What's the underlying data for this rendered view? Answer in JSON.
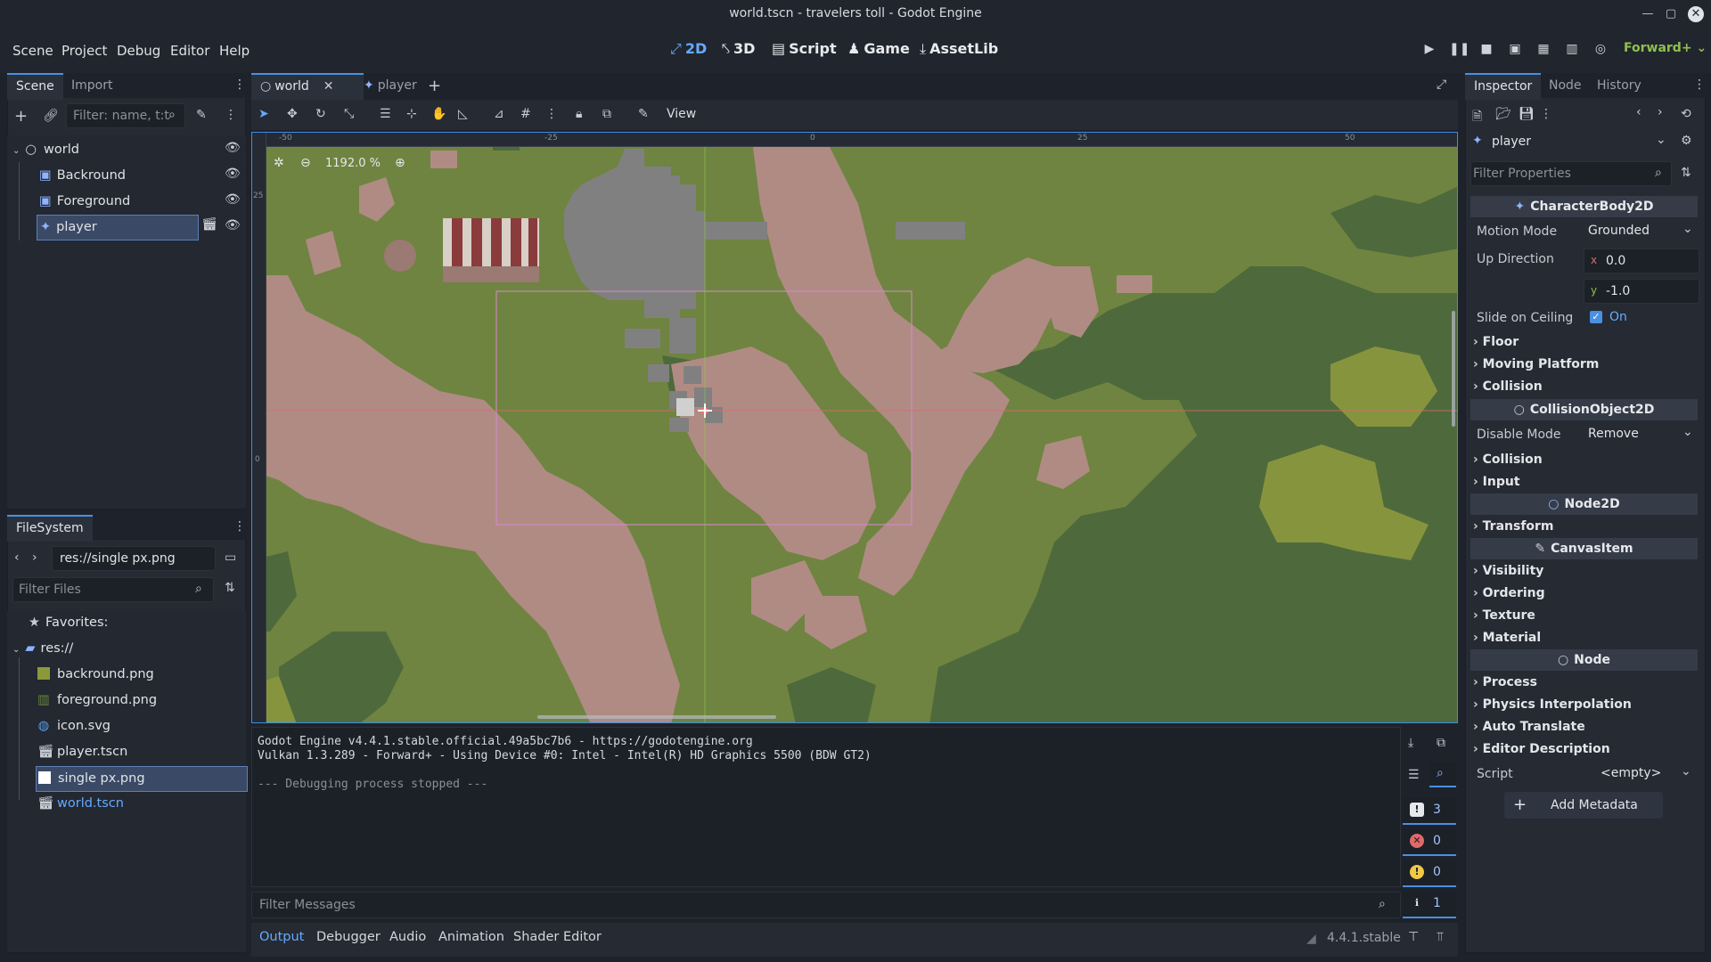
{
  "window": {
    "title": "world.tscn - travelers toll - Godot Engine"
  },
  "menu": [
    "Scene",
    "Project",
    "Debug",
    "Editor",
    "Help"
  ],
  "workspaces": [
    {
      "label": "2D",
      "icon": "2d-icon",
      "active": true
    },
    {
      "label": "3D",
      "icon": "3d-icon"
    },
    {
      "label": "Script",
      "icon": "script-icon"
    },
    {
      "label": "Game",
      "icon": "game-icon"
    },
    {
      "label": "AssetLib",
      "icon": "assetlib-icon"
    }
  ],
  "renderer": "Forward+",
  "scene_dock": {
    "tabs": [
      "Scene",
      "Import"
    ],
    "filter_placeholder": "Filter: name, t:t",
    "nodes": [
      {
        "label": "world",
        "icon": "node-circle-icon"
      },
      {
        "label": "Backround",
        "icon": "sprite-icon"
      },
      {
        "label": "Foreground",
        "icon": "sprite-icon"
      },
      {
        "label": "player",
        "icon": "character-icon",
        "selected": true
      }
    ]
  },
  "filesystem": {
    "tab": "FileSystem",
    "path": "res://single px.png",
    "filter_placeholder": "Filter Files",
    "favorites": "Favorites:",
    "root": "res://",
    "files": [
      {
        "name": "backround.png",
        "icon": "image-icon"
      },
      {
        "name": "foreground.png",
        "icon": "image-icon"
      },
      {
        "name": "icon.svg",
        "icon": "svg-icon"
      },
      {
        "name": "player.tscn",
        "icon": "scene-icon"
      },
      {
        "name": "single px.png",
        "icon": "image-icon",
        "selected": true
      },
      {
        "name": "world.tscn",
        "icon": "scene-icon",
        "link": true
      }
    ]
  },
  "editor": {
    "tabs": [
      {
        "label": "world",
        "active": true
      },
      {
        "label": "player"
      }
    ],
    "view_label": "View",
    "zoom": "1192.0 %",
    "ruler_top": [
      "-50",
      "-25",
      "0",
      "25",
      "50"
    ],
    "ruler_left": [
      "25",
      "0"
    ]
  },
  "output": {
    "lines": [
      "Godot Engine v4.4.1.stable.official.49a5bc7b6 - https://godotengine.org",
      "Vulkan 1.3.289 - Forward+ - Using Device #0: Intel - Intel(R) HD Graphics 5500 (BDW GT2)",
      "",
      "--- Debugging process stopped ---"
    ],
    "filter_placeholder": "Filter Messages",
    "counts": {
      "messages": "3",
      "errors": "0",
      "warnings": "0",
      "info": "1"
    },
    "bottom_tabs": [
      "Output",
      "Debugger",
      "Audio",
      "Animation",
      "Shader Editor"
    ],
    "version": "4.4.1.stable"
  },
  "inspector": {
    "tabs": [
      "Inspector",
      "Node",
      "History"
    ],
    "object": "player",
    "filter_placeholder": "Filter Properties",
    "classes": {
      "character": "CharacterBody2D",
      "collision_object": "CollisionObject2D",
      "node2d": "Node2D",
      "canvas_item": "CanvasItem",
      "node": "Node"
    },
    "props": {
      "motion_mode_label": "Motion Mode",
      "motion_mode": "Grounded",
      "up_direction_label": "Up Direction",
      "up_x_label": "x",
      "up_x": "0.0",
      "up_y_label": "y",
      "up_y": "-1.0",
      "slide_label": "Slide on Ceiling",
      "slide_value": "On",
      "disable_mode_label": "Disable Mode",
      "disable_mode": "Remove",
      "script_label": "Script",
      "script_value": "<empty>",
      "add_metadata": "Add Metadata"
    },
    "sections": {
      "floor": "Floor",
      "moving_platform": "Moving Platform",
      "collision": "Collision",
      "collision2": "Collision",
      "input": "Input",
      "transform": "Transform",
      "visibility": "Visibility",
      "ordering": "Ordering",
      "texture": "Texture",
      "material": "Material",
      "process": "Process",
      "physics_interp": "Physics Interpolation",
      "auto_translate": "Auto Translate",
      "editor_desc": "Editor Description"
    }
  }
}
